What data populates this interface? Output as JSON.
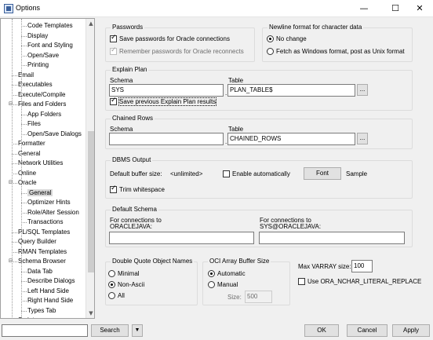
{
  "window": {
    "title": "Options",
    "minimize": "—",
    "maximize": "☐",
    "close": "✕"
  },
  "tree": {
    "items": [
      {
        "label": "Code Templates",
        "indent": 1
      },
      {
        "label": "Display",
        "indent": 1
      },
      {
        "label": "Font and Styling",
        "indent": 1
      },
      {
        "label": "Open/Save",
        "indent": 1
      },
      {
        "label": "Printing",
        "indent": 1
      },
      {
        "label": "Email",
        "indent": 0
      },
      {
        "label": "Executables",
        "indent": 0
      },
      {
        "label": "Execute/Compile",
        "indent": 0
      },
      {
        "label": "Files and Folders",
        "indent": 0,
        "expander": "⊟"
      },
      {
        "label": "App Folders",
        "indent": 1
      },
      {
        "label": "Files",
        "indent": 1
      },
      {
        "label": "Open/Save Dialogs",
        "indent": 1
      },
      {
        "label": "Formatter",
        "indent": 0
      },
      {
        "label": "General",
        "indent": 0
      },
      {
        "label": "Network Utilities",
        "indent": 0
      },
      {
        "label": "Online",
        "indent": 0
      },
      {
        "label": "Oracle",
        "indent": 0,
        "expander": "⊟"
      },
      {
        "label": "General",
        "indent": 1,
        "selected": true
      },
      {
        "label": "Optimizer Hints",
        "indent": 1
      },
      {
        "label": "Role/Alter Session",
        "indent": 1
      },
      {
        "label": "Transactions",
        "indent": 1
      },
      {
        "label": "PL/SQL Templates",
        "indent": 0
      },
      {
        "label": "Query Builder",
        "indent": 0
      },
      {
        "label": "RMAN Templates",
        "indent": 0
      },
      {
        "label": "Schema Browser",
        "indent": 0,
        "expander": "⊟"
      },
      {
        "label": "Data Tab",
        "indent": 1
      },
      {
        "label": "Describe Dialogs",
        "indent": 1
      },
      {
        "label": "Left Hand Side",
        "indent": 1
      },
      {
        "label": "Right Hand Side",
        "indent": 1
      },
      {
        "label": "Types Tab",
        "indent": 1
      },
      {
        "label": "Scripts",
        "indent": 0
      }
    ],
    "scroll_up": "▲",
    "scroll_down": "▼"
  },
  "passwords": {
    "legend": "Passwords",
    "save": "Save passwords for Oracle connections",
    "remember": "Remember passwords for Oracle reconnects"
  },
  "newline": {
    "legend": "Newline format for character data",
    "no_change": "No change",
    "fetch": "Fetch as Windows format, post as Unix format"
  },
  "explain_plan": {
    "legend": "Explain Plan",
    "schema_label": "Schema",
    "schema_value": "SYS",
    "table_label": "Table",
    "table_value": "PLAN_TABLE$",
    "dot": ".",
    "browse": "...",
    "save_previous": "Save previous Explain Plan results"
  },
  "chained_rows": {
    "legend": "Chained Rows",
    "schema_label": "Schema",
    "schema_value": "",
    "table_label": "Table",
    "table_value": "CHAINED_ROWS",
    "dot": ".",
    "browse": "..."
  },
  "dbms_output": {
    "legend": "DBMS Output",
    "buffer_label": "Default buffer size:",
    "buffer_value": "<unlimited>",
    "enable_auto": "Enable automatically",
    "font_button": "Font",
    "sample": "Sample",
    "trim": "Trim whitespace"
  },
  "default_schema": {
    "legend": "Default Schema",
    "left_label_1": "For connections to",
    "left_label_2": "ORACLEJAVA:",
    "right_label_1": "For connections to",
    "right_label_2": "SYS@ORACLEJAVA:",
    "left_value": "",
    "right_value": ""
  },
  "double_quote": {
    "legend": "Double Quote Object Names",
    "minimal": "Minimal",
    "non_ascii": "Non-Ascii",
    "all": "All"
  },
  "oci_buffer": {
    "legend": "OCI Array Buffer Size",
    "automatic": "Automatic",
    "manual": "Manual",
    "size_label": "Size:",
    "size_value": "500"
  },
  "varray": {
    "label": "Max VARRAY size:",
    "value": "100",
    "nchar": "Use ORA_NCHAR_LITERAL_REPLACE"
  },
  "footer": {
    "search_value": "",
    "search_button": "Search",
    "dropdown": "▼",
    "ok": "OK",
    "cancel": "Cancel",
    "apply": "Apply"
  }
}
